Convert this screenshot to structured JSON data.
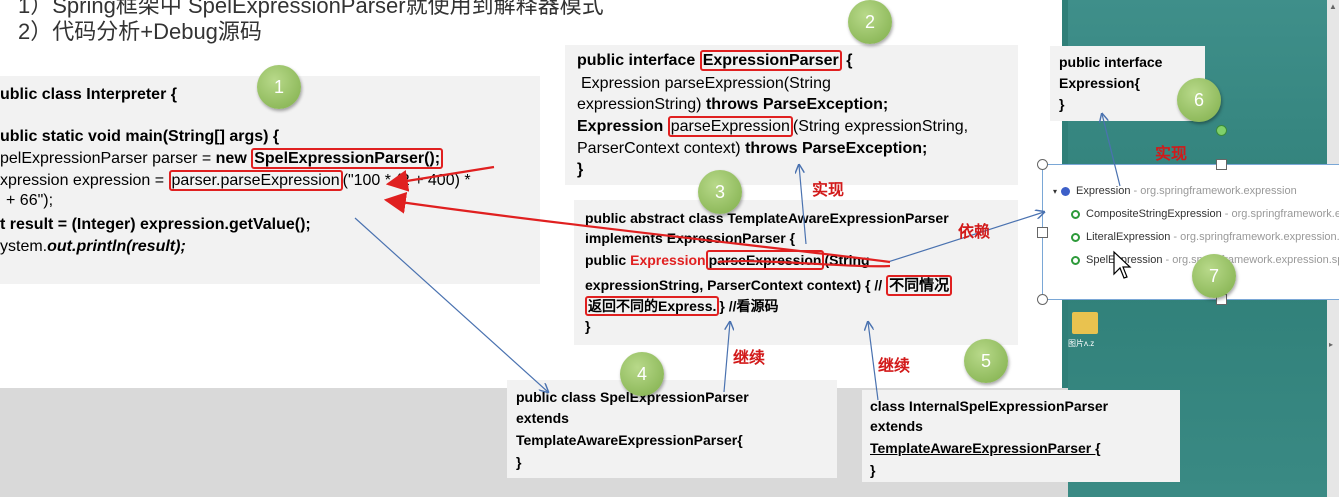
{
  "slide_text": {
    "line1": "1）Spring框架中 SpelExpressionParser就使用到解释器模式",
    "line2": "2）代码分析+Debug源码"
  },
  "badges": [
    "1",
    "2",
    "3",
    "4",
    "5",
    "6",
    "7"
  ],
  "box_interpreter": {
    "l1": "ublic class Interpreter {",
    "l2": "ublic static void main(String[] args) {",
    "l3a": "pelExpressionParser parser = ",
    "l3b": "new ",
    "l3c": "SpelExpressionParser();",
    "l4a": "xpression expression = ",
    "l4b": "parser.parseExpression",
    "l4c": "(\"100 * (2 + 400) *",
    "l5": "+ 66\");",
    "l6": "t result = (Integer) expression.getValue();",
    "l7a": "ystem.",
    "l7b": "out.println(result);"
  },
  "box_parser": {
    "l1a": "public interface ",
    "l1b": "ExpressionParser",
    "l1c": " {",
    "l2": "Expression parseExpression(String",
    "l3a": "expressionString) ",
    "l3b": "throws ParseException;",
    "l4a": "Expression ",
    "l4b": "parseExpression",
    "l4c": "(String expressionString,",
    "l5a": "ParserContext context) ",
    "l5b": "throws ParseException;",
    "l6": "}"
  },
  "box_template": {
    "l1": "public abstract class TemplateAwareExpressionParser",
    "l2": "implements ExpressionParser {",
    "l3a": "public ",
    "l3b": "Expression",
    "l3c": "parseExpression",
    "l3d": "(String",
    "l4": "expressionString, ParserContext context) { //",
    "l4b": "不同情况",
    "l5a": "返回不同的Express.",
    "l5b": "} //看源码",
    "l6": "}"
  },
  "box_spel": {
    "l1": "public class SpelExpressionParser",
    "l2": "extends",
    "l3": "TemplateAwareExpressionParser{",
    "l4": "}"
  },
  "box_internal": {
    "l1": "class InternalSpelExpressionParser",
    "l2": "extends",
    "l3": "TemplateAwareExpressionParser {",
    "l4": "}"
  },
  "box_expression": {
    "l1": "public interface",
    "l2": "Expression{",
    "l3": "}"
  },
  "labels": {
    "impl1": "实现",
    "impl2": "实现",
    "depend": "依赖",
    "inherit1": "继续",
    "inherit2": "继续"
  },
  "ide": {
    "r1_name": "Expression",
    "r1_pkg": " - org.springframework.expression",
    "r2_name": "CompositeStringExpression",
    "r2_pkg": " - org.springframework.express",
    "r3_name": "LiteralExpression",
    "r3_pkg": " - org.springframework.expression.commo",
    "r4_name": "SpelExpression",
    "r4_pkg": " - org.springframework.expression.spel.stan"
  },
  "desktop": {
    "folder_label": "图片ʌ.z"
  }
}
